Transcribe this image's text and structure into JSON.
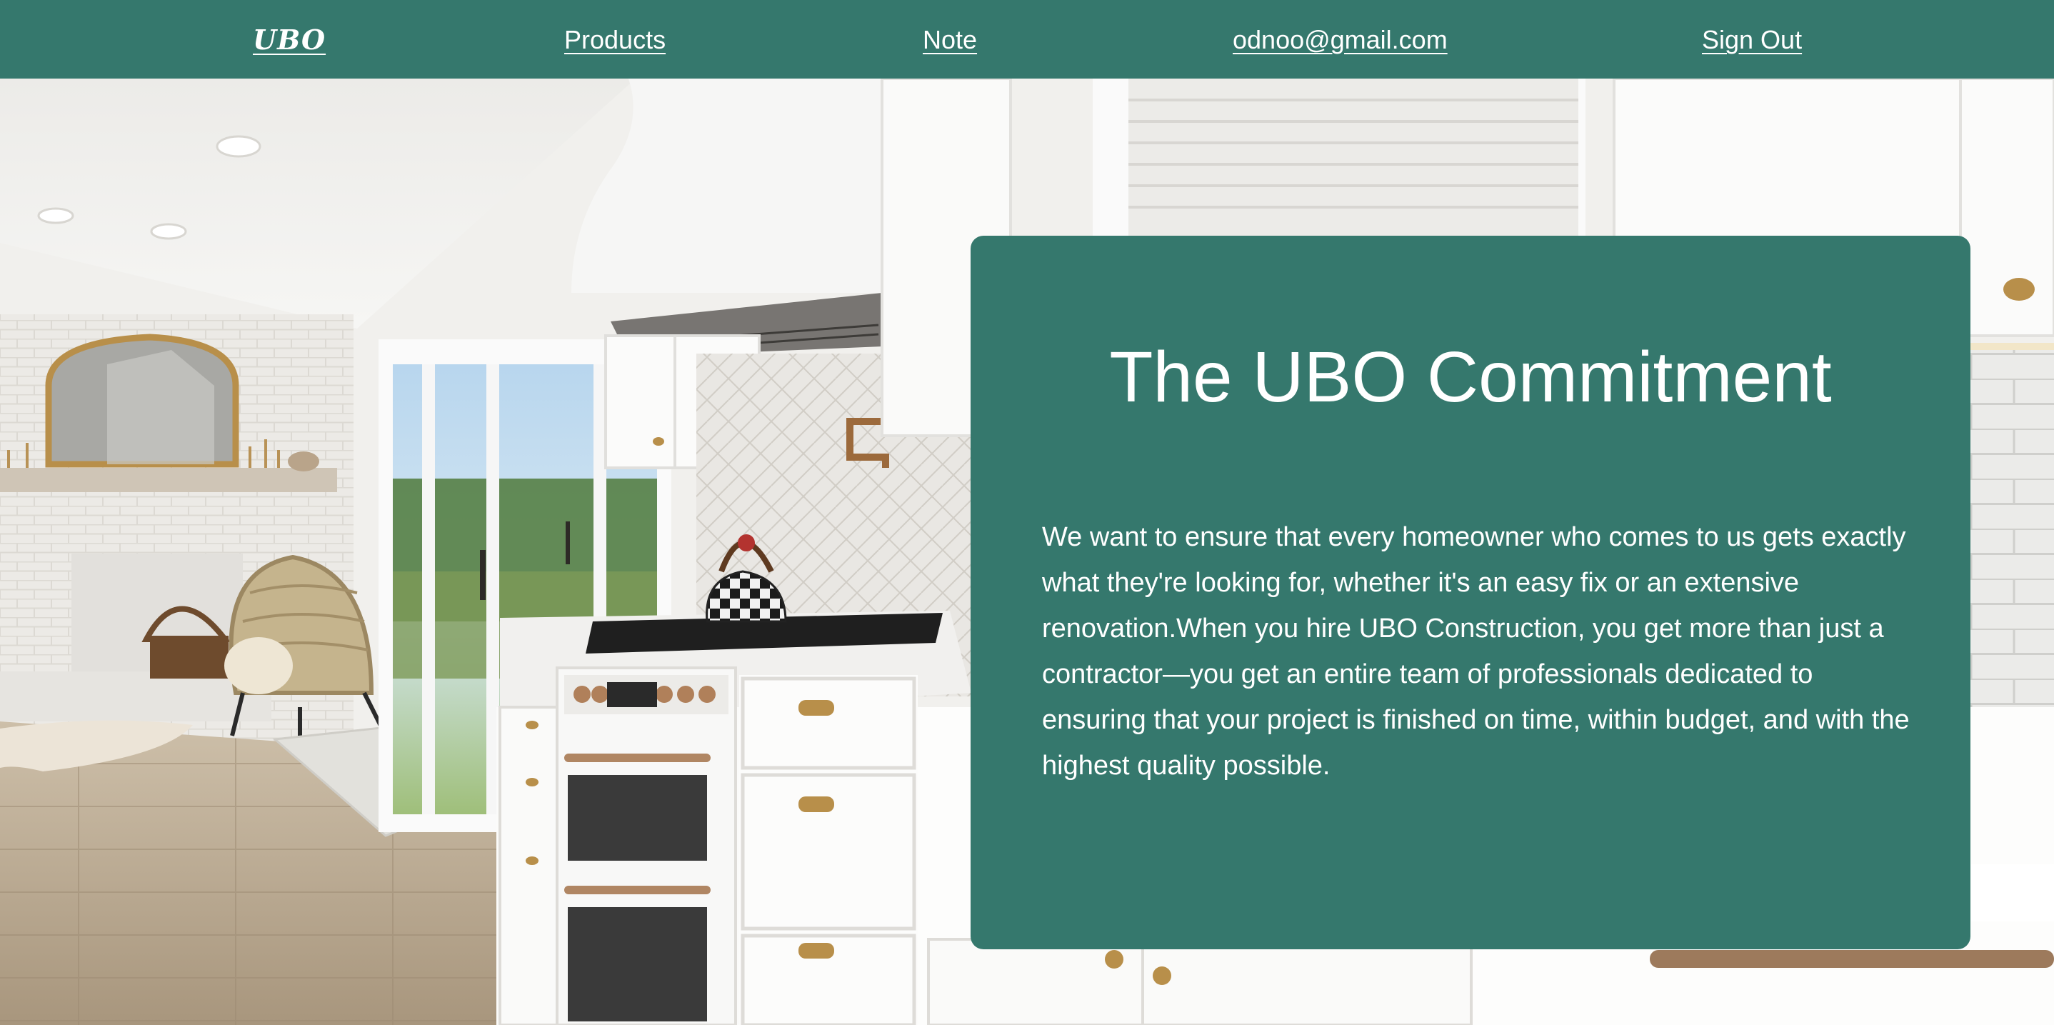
{
  "nav": {
    "brand": "UBO",
    "links": [
      "Products",
      "Note",
      "odnoo@gmail.com",
      "Sign Out"
    ]
  },
  "hero": {
    "image": "kitchen-living-room-photo"
  },
  "commitment": {
    "title": "The UBO Commitment",
    "body": "We want to ensure that every homeowner who comes to us gets exactly what they're looking for, whether it's an easy fix or an extensive renovation.When you hire UBO Construction, you get more than just a contractor—you get an entire team of professionals dedicated to ensuring that your project is finished on time, within budget, and with the highest quality possible."
  },
  "colors": {
    "brand_green": "#35786d",
    "text_on_green": "#ffffff"
  }
}
